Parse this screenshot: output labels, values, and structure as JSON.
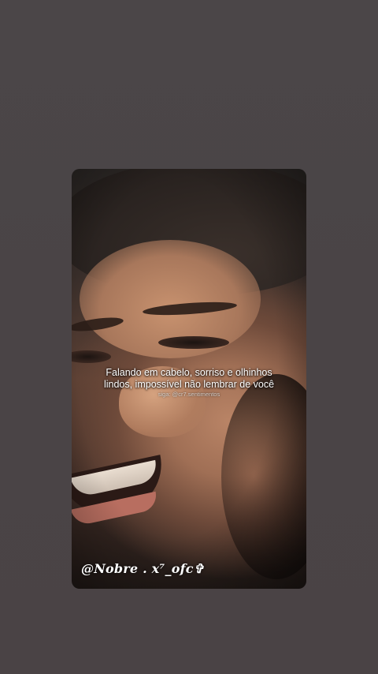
{
  "story": {
    "caption_lines": [
      "Falando em cabelo, sorriso e olhinhos",
      "lindos, impossível não lembrar de você"
    ],
    "credit": "siga: @cr7.sentimentos",
    "username": "@Nobre . x⁷_ofc✞"
  },
  "colors": {
    "background": "#4a4547",
    "caption_text": "#ffffff"
  }
}
